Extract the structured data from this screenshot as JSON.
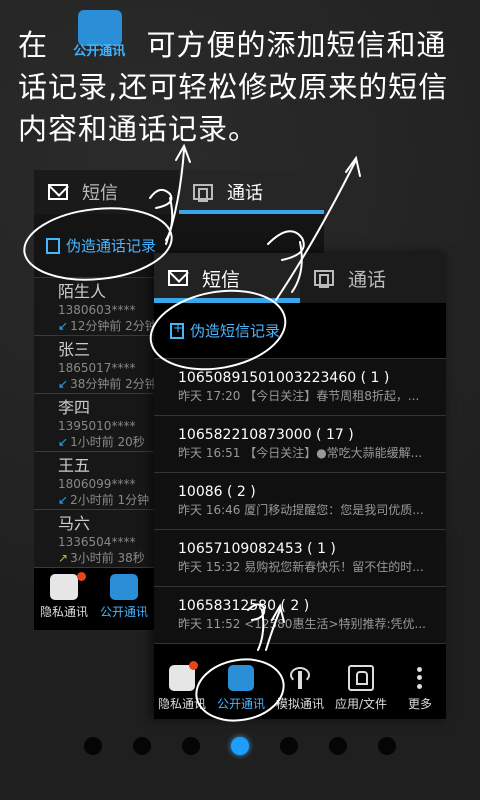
{
  "headline": {
    "prefix": "在",
    "badge_label": "公开通讯",
    "suffix": "可方便的添加短信和通话记录,还可轻松修改原来的短信内容和通话记录。"
  },
  "back_screen": {
    "tabs": [
      {
        "label": "短信",
        "icon": "envelope-icon"
      },
      {
        "label": "通话",
        "icon": "copy-icon"
      }
    ],
    "action_label": "伪造通话记录",
    "contacts": [
      {
        "name": "陌生人",
        "number": "1380603****",
        "meta": "12分钟前 2分钟",
        "dir": "in"
      },
      {
        "name": "张三",
        "number": "1865017****",
        "meta": "38分钟前 2分钟",
        "dir": "in"
      },
      {
        "name": "李四",
        "number": "1395010****",
        "meta": "1小时前 20秒",
        "dir": "in"
      },
      {
        "name": "王五",
        "number": "1806099****",
        "meta": "2小时前 1分钟",
        "dir": "in"
      },
      {
        "name": "马六",
        "number": "1336504****",
        "meta": "3小时前 38秒",
        "dir": "out"
      }
    ],
    "nav": [
      {
        "label": "隐私通讯",
        "icon": "private-comm-icon"
      },
      {
        "label": "公开通讯",
        "icon": "public-comm-icon"
      }
    ]
  },
  "front_screen": {
    "tabs": [
      {
        "label": "短信",
        "icon": "envelope-icon"
      },
      {
        "label": "通话",
        "icon": "copy-icon"
      }
    ],
    "action_label": "伪造短信记录",
    "messages": [
      {
        "from": "10650891501003223460 ( 1 )",
        "preview": "昨天 17:20 【今日关注】春节周租8折起，..."
      },
      {
        "from": "10658221087300​0 ( 17 )",
        "preview": "昨天 16:51 【今日关注】●常吃大蒜能缓解..."
      },
      {
        "from": "10086 ( 2 )",
        "preview": "昨天 16:46 厦门移动提醒您：您是我司优质..."
      },
      {
        "from": "10657109082453 ( 1 )",
        "preview": "昨天 15:32 易购祝您新春快乐！留不住的时..."
      },
      {
        "from": "10658312580 ( 2 )",
        "preview": "昨天 11:52 <12580惠生活>特别推荐:凭优..."
      }
    ],
    "nav": [
      {
        "label": "隐私通讯",
        "icon": "private-comm-icon"
      },
      {
        "label": "公开通讯",
        "icon": "public-comm-icon"
      },
      {
        "label": "模拟通讯",
        "icon": "antenna-icon"
      },
      {
        "label": "应用/文件",
        "icon": "lock-icon"
      },
      {
        "label": "更多",
        "icon": "more-dots-icon"
      }
    ]
  },
  "pager": {
    "count": 7,
    "active_index": 3
  },
  "colors": {
    "accent": "#3aa6e8",
    "badge": "#e8431a",
    "background": "#232323"
  }
}
